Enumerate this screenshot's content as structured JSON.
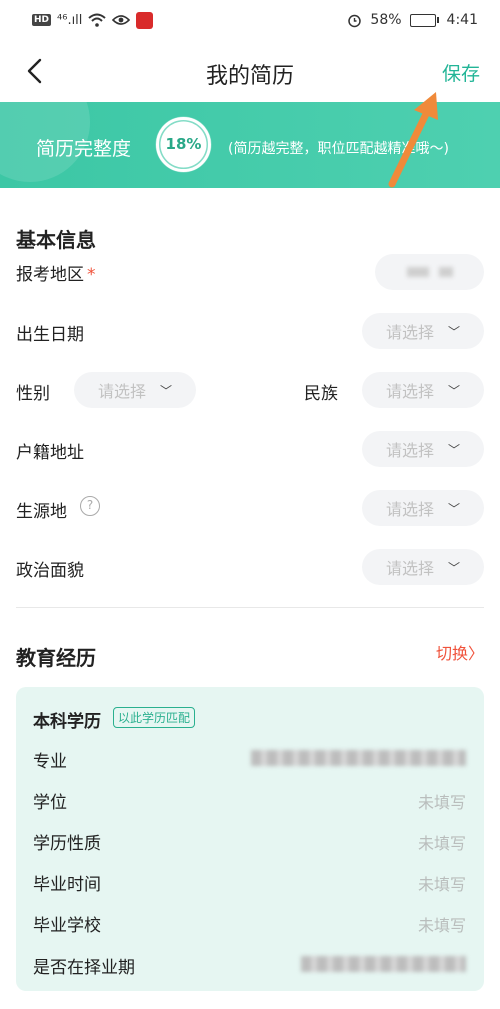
{
  "status_bar": {
    "hd": "HD",
    "network": "⁴⁶.ıll",
    "battery": "58%",
    "battery_level": 0.58,
    "time": "4:41"
  },
  "nav": {
    "title": "我的简历",
    "save": "保存"
  },
  "banner": {
    "label": "简历完整度",
    "percent": "18%",
    "percent_value": 0.18,
    "hint": "(简历越完整，职位匹配越精准哦～)"
  },
  "basic_info": {
    "title": "基本信息",
    "region_label": "报考地区",
    "required_mark": "*",
    "birth_label": "出生日期",
    "gender_label": "性别",
    "ethnicity_label": "民族",
    "domicile_label": "户籍地址",
    "origin_label": "生源地",
    "help_glyph": "?",
    "politics_label": "政治面貌",
    "placeholder": "请选择",
    "chevron": "﹀"
  },
  "education": {
    "title": "教育经历",
    "switch": "切换",
    "switch_chevron": "〉",
    "card_title": "本科学历",
    "card_tag": "以此学历匹配",
    "rows": [
      {
        "label": "专业",
        "value": ""
      },
      {
        "label": "学位",
        "value": "未填写"
      },
      {
        "label": "学历性质",
        "value": "未填写"
      },
      {
        "label": "毕业时间",
        "value": "未填写"
      },
      {
        "label": "毕业学校",
        "value": "未填写"
      },
      {
        "label": "是否在择业期",
        "value": ""
      }
    ]
  },
  "colors": {
    "accent": "#22b597",
    "banner": "#3cc7a5",
    "required": "#f0533c",
    "card": "#e6f6f2"
  },
  "icons": [
    "back-chevron-icon",
    "wifi-icon",
    "eye-icon",
    "alarm-icon",
    "battery-icon",
    "help-icon",
    "chevron-down-icon",
    "chevron-right-icon",
    "arrow-pointer-icon"
  ]
}
